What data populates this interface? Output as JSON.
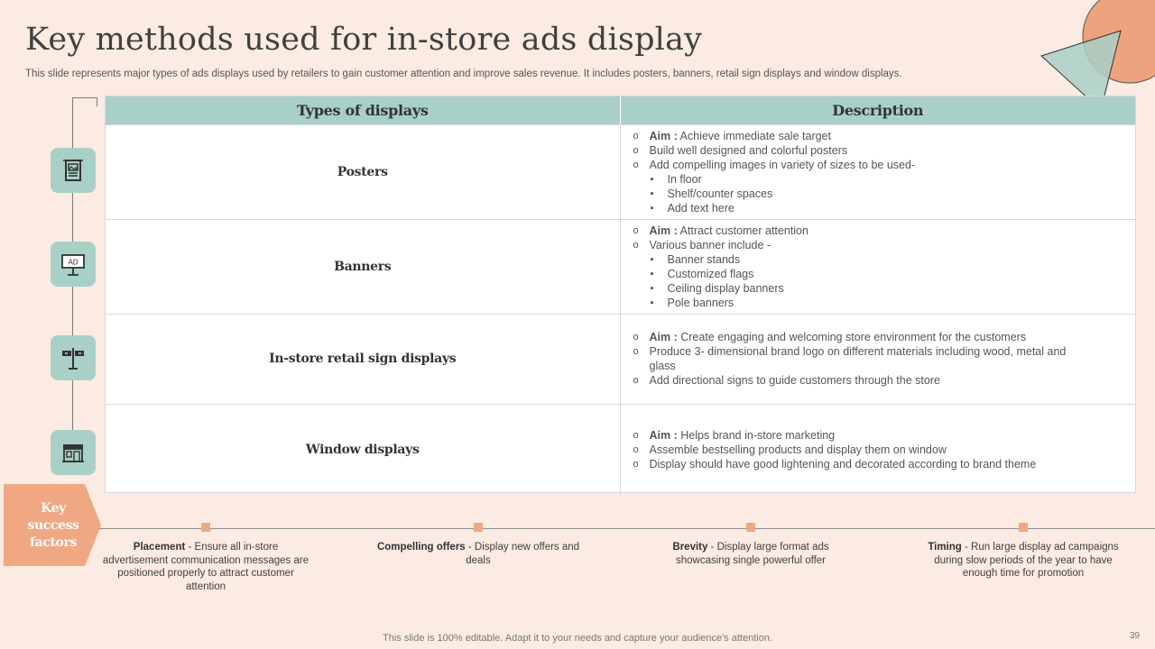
{
  "title": "Key methods used for in-store ads display",
  "subtitle": "This slide represents major types of ads displays used by retailers to gain customer attention and improve sales revenue. It includes posters, banners, retail sign displays and window displays.",
  "table": {
    "headers": [
      "Types of displays",
      "Description"
    ],
    "rows": [
      {
        "type": "Posters",
        "icon": "poster-icon",
        "aim_label": "Aim :",
        "aim_text": " Achieve immediate sale target",
        "points": [
          "Build well designed and colorful posters",
          "Add compelling images in variety of sizes to be used-"
        ],
        "subpoints": [
          "In floor",
          "Shelf/counter spaces",
          "Add text here"
        ]
      },
      {
        "type": "Banners",
        "icon": "billboard-ad-icon",
        "icon_text": "AD",
        "aim_label": "Aim :",
        "aim_text": " Attract customer attention",
        "points": [
          "Various banner include -"
        ],
        "subpoints": [
          "Banner stands",
          "Customized flags",
          "Ceiling display banners",
          "Pole banners"
        ]
      },
      {
        "type": "In-store retail sign displays",
        "icon": "direction-sign-icon",
        "aim_label": "Aim :",
        "aim_text": " Create engaging and welcoming store environment for the customers",
        "points": [
          "Produce 3- dimensional brand logo on different materials including wood, metal and glass",
          "Add directional signs to guide customers through the store"
        ],
        "subpoints": []
      },
      {
        "type": "Window displays",
        "icon": "storefront-icon",
        "aim_label": "Aim :",
        "aim_text": " Helps brand in-store marketing",
        "points": [
          "Assemble bestselling products and display them on window",
          "Display should have good lightening and decorated according to brand theme"
        ],
        "subpoints": []
      }
    ]
  },
  "ksf": {
    "label_line1": "Key",
    "label_line2": "success",
    "label_line3": "factors",
    "items": [
      {
        "name": "Placement",
        "text": " - Ensure all in-store advertisement communication messages are positioned properly to attract customer attention"
      },
      {
        "name": "Compelling offers",
        "text": " - Display new offers and deals"
      },
      {
        "name": "Brevity",
        "text": " - Display large format ads showcasing single powerful offer"
      },
      {
        "name": "Timing",
        "text": " - Run large display ad campaigns during slow periods of the year to have enough time for promotion"
      }
    ]
  },
  "footer": "This slide is 100% editable. Adapt it to your needs and capture your audience's attention.",
  "page_number": "39",
  "colors": {
    "background": "#fbebe2",
    "teal": "#a9d0c7",
    "orange": "#f0a883",
    "text": "#404040"
  }
}
